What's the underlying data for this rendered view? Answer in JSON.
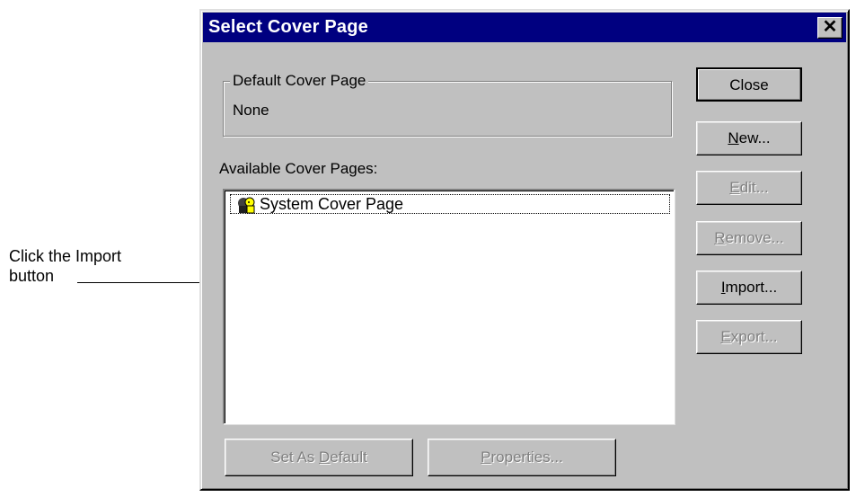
{
  "annotation": {
    "line1": "Click the Import",
    "line2": "button"
  },
  "dialog": {
    "title": "Select Cover Page",
    "close_glyph": "✕",
    "default_group": {
      "legend": "Default Cover Page",
      "value": "None"
    },
    "available_label": "Available Cover Pages:",
    "list_items": [
      {
        "label": "System Cover Page",
        "icon": "cover-page-icon"
      }
    ],
    "buttons": {
      "close": "Close",
      "new": {
        "underline": "N",
        "rest": "ew..."
      },
      "edit": {
        "underline": "E",
        "rest": "dit..."
      },
      "remove": {
        "underline": "R",
        "rest": "emove..."
      },
      "import": {
        "underline": "I",
        "rest": "mport..."
      },
      "export": {
        "underline": "E",
        "rest": "xport..."
      },
      "set_default": {
        "pre": "Set As ",
        "underline": "D",
        "rest": "efault"
      },
      "properties": {
        "underline": "P",
        "rest": "roperties..."
      }
    }
  },
  "colors": {
    "titlebar": "#000080",
    "face": "#c0c0c0",
    "disabled_text": "#808080"
  }
}
